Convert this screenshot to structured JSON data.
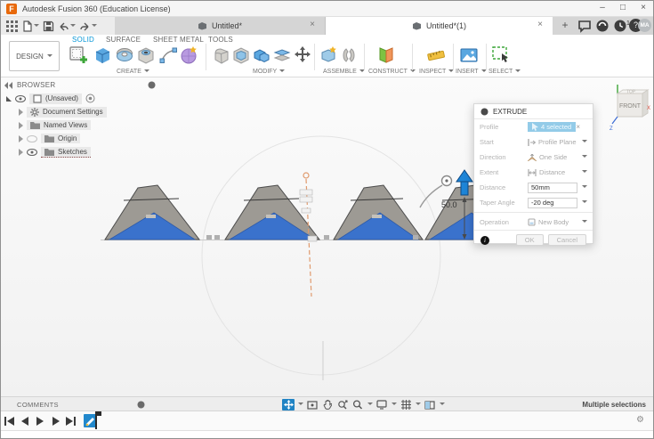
{
  "window": {
    "title": "Autodesk Fusion 360 (Education License)",
    "controls": {
      "minimize": "–",
      "maximize": "□",
      "close": "×"
    }
  },
  "icons_text": {
    "close": "×",
    "plus": "+",
    "gear": "⚙",
    "help": "?",
    "info": "i"
  },
  "colors": {
    "accent_blue": "#0696d7",
    "selection_blue": "#1f83c4",
    "shape_gray": "#9d9a94",
    "shape_blue": "#3a72cc",
    "construction_orange": "#e09a6d",
    "form_purple": "#b89ae0",
    "logo_orange": "#e8690b"
  },
  "tabs": {
    "items": [
      {
        "label": "Untitled*"
      },
      {
        "label": "Untitled*(1)",
        "active": true
      }
    ],
    "notification_count": "1",
    "avatar_initials": "MA"
  },
  "ribbon": {
    "design_menu_label": "DESIGN",
    "tabs": [
      {
        "label": "SOLID",
        "active": true
      },
      {
        "label": "SURFACE"
      },
      {
        "label": "SHEET METAL"
      },
      {
        "label": "TOOLS"
      }
    ],
    "groups": [
      {
        "label": "CREATE"
      },
      {
        "label": "MODIFY"
      },
      {
        "label": "ASSEMBLE"
      },
      {
        "label": "CONSTRUCT"
      },
      {
        "label": "INSPECT"
      },
      {
        "label": "INSERT"
      },
      {
        "label": "SELECT"
      }
    ]
  },
  "browser": {
    "header": "BROWSER",
    "root_label": "(Unsaved)",
    "items": [
      {
        "label": "Document Settings"
      },
      {
        "label": "Named Views"
      },
      {
        "label": "Origin"
      },
      {
        "label": "Sketches"
      }
    ]
  },
  "viewcube": {
    "front": "FRONT",
    "top": "TOP",
    "axis_x": "X",
    "axis_z": "Z"
  },
  "canvas": {
    "extrude_dimension_label": "50.0"
  },
  "dialog": {
    "title": "EXTRUDE",
    "rows": {
      "profile": {
        "label": "Profile",
        "value": "4 selected"
      },
      "start": {
        "label": "Start",
        "value": "Profile Plane"
      },
      "direction": {
        "label": "Direction",
        "value": "One Side"
      },
      "extent": {
        "label": "Extent",
        "value": "Distance"
      },
      "distance": {
        "label": "Distance",
        "value": "50mm"
      },
      "taper": {
        "label": "Taper Angle",
        "value": "-20 deg"
      },
      "operation": {
        "label": "Operation",
        "value": "New Body"
      }
    },
    "buttons": {
      "ok": "OK",
      "cancel": "Cancel"
    }
  },
  "bottom": {
    "comments_label": "COMMENTS",
    "status_text": "Multiple selections"
  }
}
